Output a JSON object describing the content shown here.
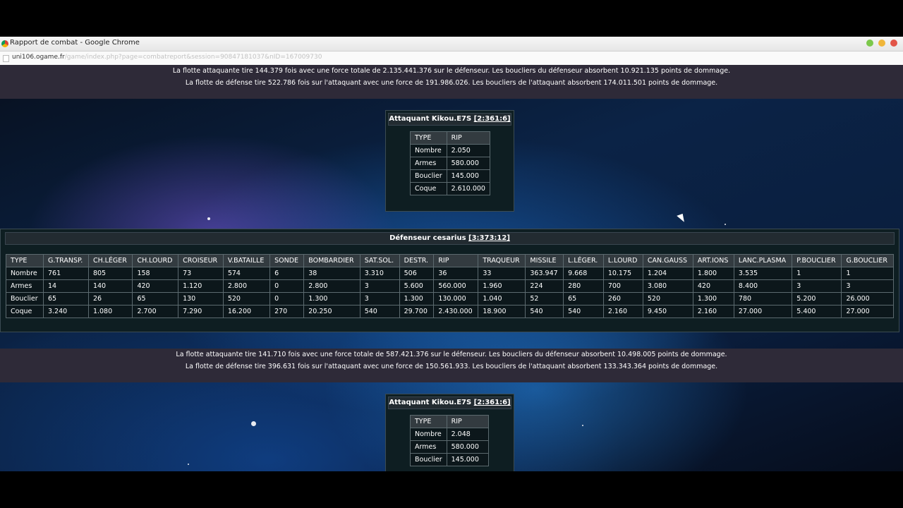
{
  "window": {
    "title": "Rapport de combat - Google Chrome",
    "url_host": "uni106.ogame.fr",
    "url_path": "/game/index.php?page=combatreport&session=90847181037&nID=167009730"
  },
  "colors": {
    "panel_bg": "#0e1e22",
    "message_bg": "#2e2a38",
    "header_cell": "#333b40"
  },
  "rounds": [
    {
      "attacker_line": "La flotte attaquante tire 144.379 fois avec une force totale de 2.135.441.376 sur le défenseur. Les boucliers du défenseur absorbent 10.921.135 points de dommage.",
      "defender_line": "La flotte de défense tire 522.786 fois sur l'attaquant avec une force de 191.986.026. Les boucliers de l'attaquant absorbent 174.011.501 points de dommage."
    },
    {
      "attacker_line": "La flotte attaquante tire 141.710 fois avec une force totale de 587.421.376 sur le défenseur. Les boucliers du défenseur absorbent 10.498.005 points de dommage.",
      "defender_line": "La flotte de défense tire 396.631 fois sur l'attaquant avec une force de 150.561.933. Les boucliers de l'attaquant absorbent 133.343.364 points de dommage."
    }
  ],
  "attacker1": {
    "label": "Attaquant Kikou.E7S",
    "coords": "[2:361:6]",
    "type_header": "TYPE",
    "ship": "RIP",
    "rows": [
      {
        "label": "Nombre",
        "value": "2.050"
      },
      {
        "label": "Armes",
        "value": "580.000"
      },
      {
        "label": "Bouclier",
        "value": "145.000"
      },
      {
        "label": "Coque",
        "value": "2.610.000"
      }
    ]
  },
  "defender": {
    "label": "Défenseur cesarius",
    "coords": "[3:373:12]",
    "headers": [
      "TYPE",
      "G.TRANSP.",
      "CH.LÉGER",
      "CH.LOURD",
      "CROISEUR",
      "V.BATAILLE",
      "SONDE",
      "BOMBARDIER",
      "SAT.SOL.",
      "DESTR.",
      "RIP",
      "TRAQUEUR",
      "MISSILE",
      "L.LÉGER.",
      "L.LOURD",
      "CAN.GAUSS",
      "ART.IONS",
      "LANC.PLASMA",
      "P.BOUCLIER",
      "G.BOUCLIER"
    ],
    "rows": [
      [
        "Nombre",
        "761",
        "805",
        "158",
        "73",
        "574",
        "6",
        "38",
        "3.310",
        "506",
        "36",
        "33",
        "363.947",
        "9.668",
        "10.175",
        "1.204",
        "1.800",
        "3.535",
        "1",
        "1"
      ],
      [
        "Armes",
        "14",
        "140",
        "420",
        "1.120",
        "2.800",
        "0",
        "2.800",
        "3",
        "5.600",
        "560.000",
        "1.960",
        "224",
        "280",
        "700",
        "3.080",
        "420",
        "8.400",
        "3",
        "3"
      ],
      [
        "Bouclier",
        "65",
        "26",
        "65",
        "130",
        "520",
        "0",
        "1.300",
        "3",
        "1.300",
        "130.000",
        "1.040",
        "52",
        "65",
        "260",
        "520",
        "1.300",
        "780",
        "5.200",
        "26.000"
      ],
      [
        "Coque",
        "3.240",
        "1.080",
        "2.700",
        "7.290",
        "16.200",
        "270",
        "20.250",
        "540",
        "29.700",
        "2.430.000",
        "18.900",
        "540",
        "540",
        "2.160",
        "9.450",
        "2.160",
        "27.000",
        "5.400",
        "27.000"
      ]
    ]
  },
  "attacker2": {
    "label": "Attaquant Kikou.E7S",
    "coords": "[2:361:6]",
    "type_header": "TYPE",
    "ship": "RIP",
    "rows": [
      {
        "label": "Nombre",
        "value": "2.048"
      },
      {
        "label": "Armes",
        "value": "580.000"
      },
      {
        "label": "Bouclier",
        "value": "145.000"
      }
    ]
  }
}
